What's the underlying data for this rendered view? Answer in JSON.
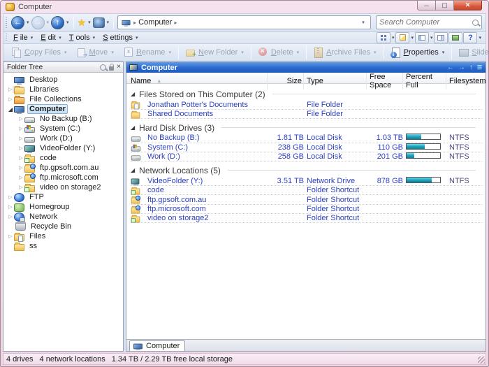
{
  "window": {
    "title": "Computer"
  },
  "nav": {
    "buttons": [
      {
        "name": "back",
        "enabled": true,
        "dropdown": true
      },
      {
        "name": "forward",
        "enabled": false,
        "dropdown": true
      },
      {
        "name": "up",
        "enabled": true,
        "dropdown": true
      },
      {
        "name": "favorites",
        "enabled": true,
        "dropdown": true
      },
      {
        "name": "locations",
        "enabled": true,
        "dropdown": true
      }
    ],
    "address": {
      "crumb": "Computer"
    },
    "search": {
      "placeholder": "Search Computer"
    }
  },
  "menus": [
    "File",
    "Edit",
    "Tools",
    "Settings"
  ],
  "menu_right_buttons": [
    {
      "name": "view-mode",
      "glyph": "grid",
      "dropdown": true
    },
    {
      "name": "checkbox-mode",
      "glyph": "pencil",
      "dropdown": true
    },
    {
      "name": "folder-format",
      "glyph": "panes",
      "dropdown": true
    },
    {
      "name": "dual-display",
      "glyph": "dual",
      "dropdown": false
    },
    {
      "name": "viewer-pane",
      "glyph": "pic",
      "dropdown": false
    },
    {
      "name": "help",
      "glyph": "help",
      "dropdown": true
    }
  ],
  "toolbar": [
    {
      "label": "Copy Files",
      "icon": "copy",
      "enabled": false,
      "dropdown": true,
      "group": 1
    },
    {
      "label": "Move",
      "icon": "move",
      "enabled": false,
      "dropdown": true,
      "group": 1
    },
    {
      "label": "Rename",
      "icon": "rename",
      "enabled": false,
      "dropdown": true,
      "group": 1
    },
    {
      "label": "New Folder",
      "icon": "new-folder",
      "enabled": false,
      "dropdown": true,
      "group": 2
    },
    {
      "label": "Delete",
      "icon": "delete",
      "enabled": false,
      "dropdown": true,
      "group": 3
    },
    {
      "label": "Archive Files",
      "icon": "archive",
      "enabled": false,
      "dropdown": true,
      "group": 4
    },
    {
      "label": "Properties",
      "icon": "properties",
      "enabled": true,
      "dropdown": true,
      "group": 5
    },
    {
      "label": "Slideshow",
      "icon": "slideshow",
      "enabled": false,
      "dropdown": false,
      "group": 6
    }
  ],
  "folder_tree": {
    "header": "Folder Tree",
    "items": [
      {
        "label": "Desktop",
        "icon": "desktop",
        "level": 0,
        "expander": "none"
      },
      {
        "label": "Libraries",
        "icon": "libraries",
        "level": 0,
        "expander": "collapsed"
      },
      {
        "label": "File Collections",
        "icon": "collections",
        "level": 0,
        "expander": "collapsed"
      },
      {
        "label": "Computer",
        "icon": "computer",
        "level": 0,
        "expander": "expanded",
        "selected": true
      },
      {
        "label": "No Backup (B:)",
        "icon": "drive",
        "level": 1,
        "expander": "collapsed"
      },
      {
        "label": "System (C:)",
        "icon": "drive-sys",
        "level": 1,
        "expander": "collapsed"
      },
      {
        "label": "Work (D:)",
        "icon": "drive",
        "level": 1,
        "expander": "collapsed"
      },
      {
        "label": "VideoFolder (Y:)",
        "icon": "netdrive",
        "level": 1,
        "expander": "collapsed"
      },
      {
        "label": "code",
        "icon": "folder-link",
        "level": 1,
        "expander": "collapsed"
      },
      {
        "label": "ftp.gpsoft.com.au",
        "icon": "ftp-folder",
        "level": 1,
        "expander": "collapsed"
      },
      {
        "label": "ftp.microsoft.com",
        "icon": "ftp-folder",
        "level": 1,
        "expander": "collapsed"
      },
      {
        "label": "video on storage2",
        "icon": "folder-link",
        "level": 1,
        "expander": "collapsed"
      },
      {
        "label": "FTP",
        "icon": "globe",
        "level": 0,
        "expander": "collapsed"
      },
      {
        "label": "Homegroup",
        "icon": "homegroup",
        "level": 0,
        "expander": "collapsed"
      },
      {
        "label": "Network",
        "icon": "network",
        "level": 0,
        "expander": "collapsed"
      },
      {
        "label": "Recycle Bin",
        "icon": "recycle",
        "level": 0,
        "expander": "none"
      },
      {
        "label": "Files",
        "icon": "files",
        "level": 0,
        "expander": "collapsed"
      },
      {
        "label": "ss",
        "icon": "folder",
        "level": 0,
        "expander": "none"
      }
    ]
  },
  "file_panel": {
    "title": "Computer",
    "columns": [
      {
        "label": "Name",
        "sort": "asc"
      },
      {
        "label": "Size"
      },
      {
        "label": "Type"
      },
      {
        "label": "Free Space"
      },
      {
        "label": "Percent Full"
      },
      {
        "label": "Filesystem"
      }
    ],
    "groups": [
      {
        "label": "Files Stored on This Computer (2)",
        "rows": [
          {
            "name": "Jonathan Potter's Documents",
            "icon": "user-docs",
            "size": "",
            "type": "File Folder",
            "free": "",
            "percent": null,
            "fs": ""
          },
          {
            "name": "Shared Documents",
            "icon": "shared-docs",
            "size": "",
            "type": "File Folder",
            "free": "",
            "percent": null,
            "fs": ""
          }
        ]
      },
      {
        "label": "Hard Disk Drives (3)",
        "rows": [
          {
            "name": "No Backup (B:)",
            "icon": "drive",
            "size": "1.81 TB",
            "type": "Local Disk",
            "free": "1.03 TB",
            "percent": 43,
            "fs": "NTFS"
          },
          {
            "name": "System (C:)",
            "icon": "drive-sys",
            "size": "238 GB",
            "type": "Local Disk",
            "free": "110 GB",
            "percent": 54,
            "fs": "NTFS"
          },
          {
            "name": "Work (D:)",
            "icon": "drive",
            "size": "258 GB",
            "type": "Local Disk",
            "free": "201 GB",
            "percent": 22,
            "fs": "NTFS"
          }
        ]
      },
      {
        "label": "Network Locations (5)",
        "rows": [
          {
            "name": "VideoFolder (Y:)",
            "icon": "netdrive",
            "size": "3.51 TB",
            "type": "Network Drive",
            "free": "878 GB",
            "percent": 75,
            "fs": "NTFS"
          },
          {
            "name": "code",
            "icon": "folder-link",
            "size": "",
            "type": "Folder Shortcut",
            "free": "",
            "percent": null,
            "fs": ""
          },
          {
            "name": "ftp.gpsoft.com.au",
            "icon": "ftp-folder",
            "size": "",
            "type": "Folder Shortcut",
            "free": "",
            "percent": null,
            "fs": ""
          },
          {
            "name": "ftp.microsoft.com",
            "icon": "ftp-folder",
            "size": "",
            "type": "Folder Shortcut",
            "free": "",
            "percent": null,
            "fs": ""
          },
          {
            "name": "video on storage2",
            "icon": "folder-link",
            "size": "",
            "type": "Folder Shortcut",
            "free": "",
            "percent": null,
            "fs": ""
          }
        ]
      }
    ],
    "tab": "Computer"
  },
  "status_bar": {
    "parts": [
      "4 drives",
      "4 network locations",
      "1.34 TB / 2.29 TB free local storage"
    ]
  },
  "colors": {
    "accent_blue": "#2968cd",
    "row_text": "#2b3fc0",
    "filesystem_text": "#4f4a82",
    "bar_fill": "#25a7c1",
    "frame_pink": "#f2dce8"
  }
}
